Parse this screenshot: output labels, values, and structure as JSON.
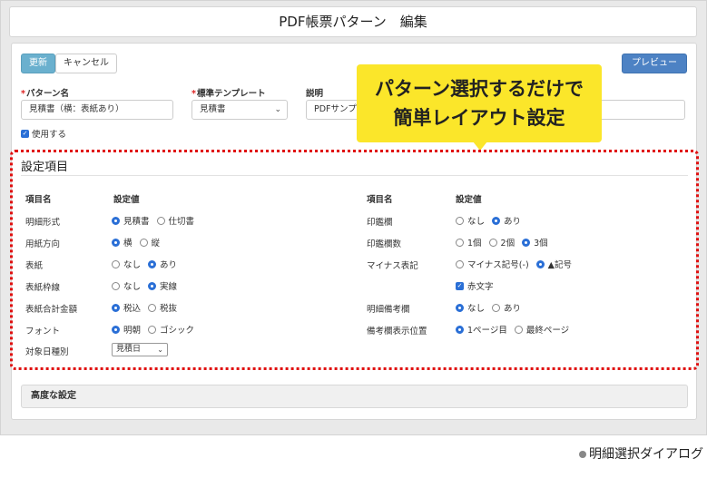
{
  "window": {
    "title": "PDF帳票パターン　編集"
  },
  "toolbar": {
    "update_label": "更新",
    "cancel_label": "キャンセル",
    "preview_label": "プレビュー"
  },
  "form": {
    "pattern_name": {
      "label": "パターン名",
      "value": "見積書（横：表紙あり）"
    },
    "standard_template": {
      "label": "標準テンプレート",
      "value": "見積書"
    },
    "description": {
      "label": "説明",
      "value": "PDFサンプル"
    },
    "use_label": "使用する"
  },
  "callout": {
    "line1": "パターン選択するだけで",
    "line2": "簡単レイアウト設定"
  },
  "settings": {
    "title": "設定項目",
    "col_item": "項目名",
    "col_value": "設定値",
    "left_rows": [
      {
        "label": "明細形式",
        "options": [
          {
            "text": "見積書",
            "checked": true
          },
          {
            "text": "仕切書",
            "checked": false
          }
        ]
      },
      {
        "label": "用紙方向",
        "options": [
          {
            "text": "横",
            "checked": true
          },
          {
            "text": "縦",
            "checked": false
          }
        ]
      },
      {
        "label": "表紙",
        "options": [
          {
            "text": "なし",
            "checked": false
          },
          {
            "text": "あり",
            "checked": true
          }
        ]
      },
      {
        "label": "表紙枠線",
        "options": [
          {
            "text": "なし",
            "checked": false
          },
          {
            "text": "実線",
            "checked": true
          }
        ]
      },
      {
        "label": "表紙合計金額",
        "options": [
          {
            "text": "税込",
            "checked": true
          },
          {
            "text": "税抜",
            "checked": false
          }
        ]
      },
      {
        "label": "フォント",
        "options": [
          {
            "text": "明朝",
            "checked": true
          },
          {
            "text": "ゴシック",
            "checked": false
          }
        ]
      }
    ],
    "target_date": {
      "label": "対象日種別",
      "value": "見積日"
    },
    "right_rows": [
      {
        "label": "印鑑欄",
        "options": [
          {
            "text": "なし",
            "checked": false
          },
          {
            "text": "あり",
            "checked": true
          }
        ]
      },
      {
        "label": "印鑑欄数",
        "options": [
          {
            "text": "1個",
            "checked": false
          },
          {
            "text": "2個",
            "checked": false
          },
          {
            "text": "3個",
            "checked": true
          }
        ]
      },
      {
        "label": "マイナス表記",
        "options": [
          {
            "text": "マイナス記号(-)",
            "checked": false
          },
          {
            "text": "▲記号",
            "checked": true
          }
        ]
      },
      {
        "label": "",
        "checkbox": "赤文字"
      },
      {
        "label": "明細備考欄",
        "options": [
          {
            "text": "なし",
            "checked": true
          },
          {
            "text": "あり",
            "checked": false
          }
        ]
      },
      {
        "label": "備考欄表示位置",
        "options": [
          {
            "text": "1ページ目",
            "checked": true
          },
          {
            "text": "最終ページ",
            "checked": false
          }
        ]
      }
    ]
  },
  "advanced": {
    "label": "高度な設定"
  },
  "caption": "明細選択ダイアログ",
  "colors": {
    "accent": "#4d82c4",
    "update": "#6ab0ce",
    "callout": "#fbe62a",
    "highlight": "#e01010"
  }
}
